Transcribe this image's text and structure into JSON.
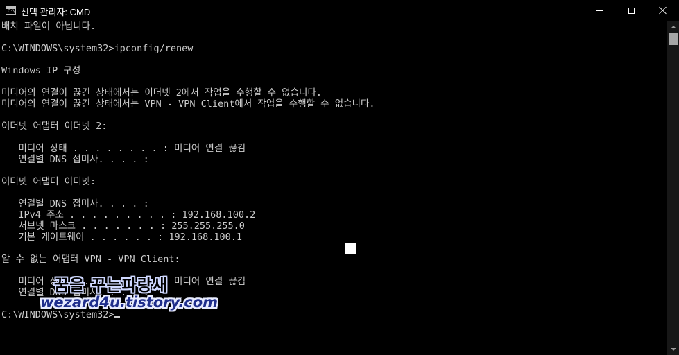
{
  "window": {
    "title": "선택 관리자: CMD",
    "icon_label": "C:\\"
  },
  "console": {
    "lines": [
      "배치 파일이 아닙니다.",
      "",
      "C:\\WINDOWS\\system32>ipconfig/renew",
      "",
      "Windows IP 구성",
      "",
      "미디어의 연결이 끊긴 상태에서는 이더넷 2에서 작업을 수행할 수 없습니다.",
      "미디어의 연결이 끊긴 상태에서는 VPN - VPN Client에서 작업을 수행할 수 없습니다.",
      "",
      "이더넷 어댑터 이더넷 2:",
      "",
      "   미디어 상태 . . . . . . . . : 미디어 연결 끊김",
      "   연결별 DNS 접미사. . . . :",
      "",
      "이더넷 어댑터 이더넷:",
      "",
      "   연결별 DNS 접미사. . . . :",
      "   IPv4 주소 . . . . . . . . . : 192.168.100.2",
      "   서브넷 마스크 . . . . . . . : 255.255.255.0",
      "   기본 게이트웨이 . . . . . . : 192.168.100.1",
      "",
      "알 수 없는 어댑터 VPN - VPN Client:",
      "",
      "   미디어 상태 . . . . . . . . : 미디어 연결 끊김",
      "   연결별 DNS 접미사. . . . :",
      "",
      "C:\\WINDOWS\\system32>"
    ]
  },
  "watermark": {
    "line1": "꿈을 꾸는파랑새",
    "line2": "wezard4u.tistory.com"
  },
  "icons": {
    "minimize": "minimize-icon",
    "maximize": "maximize-icon",
    "close": "close-icon",
    "scroll_up": "chevron-up-icon",
    "scroll_down": "chevron-down-icon"
  },
  "colors": {
    "background": "#000000",
    "text": "#cccccc",
    "scrollbar_track": "#171717",
    "scrollbar_thumb": "#a6a6a6"
  }
}
